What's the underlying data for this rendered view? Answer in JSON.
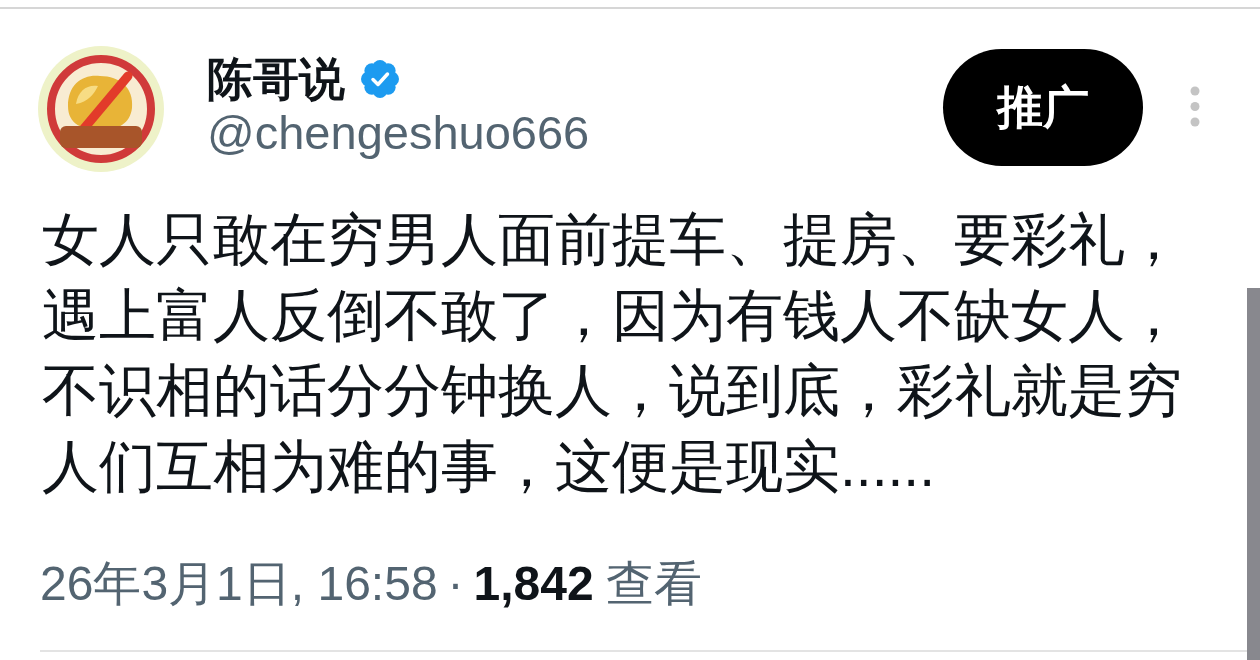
{
  "author": {
    "name": "陈哥说",
    "verified": true,
    "handle": "@chengeshuo666"
  },
  "promote_button": {
    "label": "推广"
  },
  "post": {
    "text": "女人只敢在穷男人面前提车、提房、要彩礼，遇上富人反倒不敢了，因为有钱人不缺女人，不识相的话分分钟换人，说到底，彩礼就是穷人们互相为难的事，这便是现实......"
  },
  "meta": {
    "timestamp": "26年3月1日, 16:58",
    "separator": "·",
    "views": "1,842",
    "views_label": "查看"
  }
}
